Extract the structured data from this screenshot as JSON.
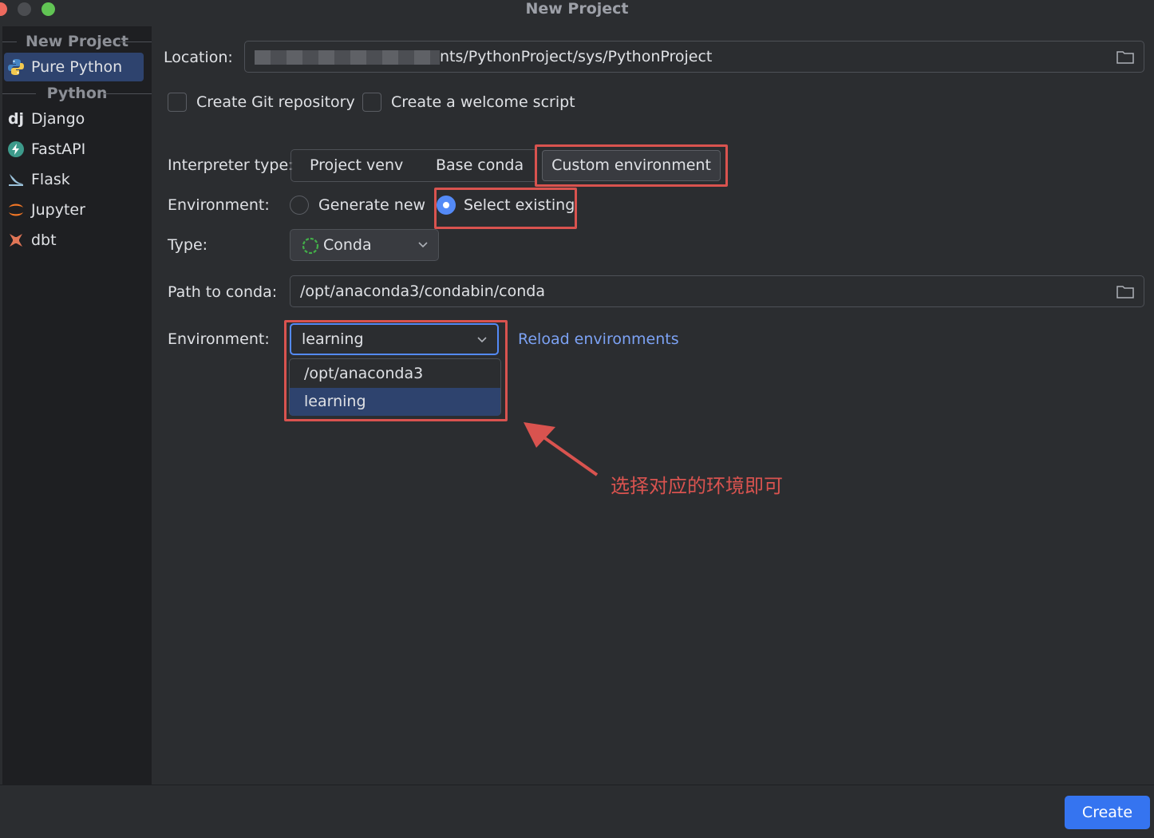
{
  "window": {
    "title": "New Project"
  },
  "colors": {
    "accent": "#3574f0",
    "selection": "#2e436e",
    "annotation": "#d9534f",
    "link": "#7ca2f4"
  },
  "sidebar": {
    "section_new_project": "New Project",
    "section_python": "Python",
    "items": [
      {
        "label": "Pure Python",
        "icon": "python-icon",
        "selected": true
      },
      {
        "label": "Django",
        "icon": "django-icon"
      },
      {
        "label": "FastAPI",
        "icon": "fastapi-icon"
      },
      {
        "label": "Flask",
        "icon": "flask-icon"
      },
      {
        "label": "Jupyter",
        "icon": "jupyter-icon"
      },
      {
        "label": "dbt",
        "icon": "dbt-icon"
      }
    ]
  },
  "form": {
    "location_label": "Location:",
    "location_value": "nts/PythonProject/sys/PythonProject",
    "create_git_label": "Create Git repository",
    "create_welcome_label": "Create a welcome script",
    "interpreter_type_label": "Interpreter type:",
    "interpreter_options": [
      "Project venv",
      "Base conda",
      "Custom environment"
    ],
    "interpreter_selected": "Custom environment",
    "environment_mode_label": "Environment:",
    "environment_modes": [
      "Generate new",
      "Select existing"
    ],
    "environment_mode_selected": "Select existing",
    "type_label": "Type:",
    "type_value": "Conda",
    "path_to_conda_label": "Path to conda:",
    "path_to_conda_value": "/opt/anaconda3/condabin/conda",
    "environment_label": "Environment:",
    "environment_value": "learning",
    "environment_options": [
      "/opt/anaconda3",
      "learning"
    ],
    "reload_link": "Reload environments"
  },
  "annotation": {
    "text": "选择对应的环境即可"
  },
  "footer": {
    "create_label": "Create"
  }
}
